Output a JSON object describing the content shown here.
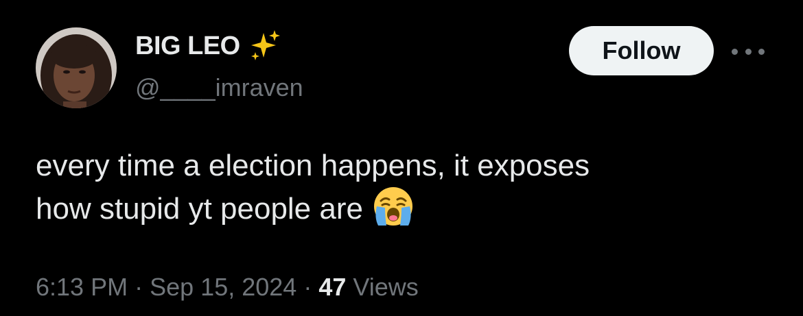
{
  "user": {
    "display_name": "BIG LEO",
    "handle": "@____imraven",
    "badge_icon": "sparkles-icon"
  },
  "actions": {
    "follow_label": "Follow",
    "more_icon": "more-horizontal-icon"
  },
  "tweet": {
    "line1": "every time a election happens, it exposes",
    "line2": "how stupid yt people are",
    "emoji": "loudly-crying-face-emoji"
  },
  "meta": {
    "time": "6:13 PM",
    "separator": "·",
    "date": "Sep 15, 2024",
    "views_count": "47",
    "views_label": "Views"
  },
  "colors": {
    "background": "#000000",
    "primary_text": "#e7e9ea",
    "secondary_text": "#71767b",
    "follow_bg": "#eff3f4",
    "follow_text": "#0f1419",
    "sparkle": "#f5c518"
  }
}
